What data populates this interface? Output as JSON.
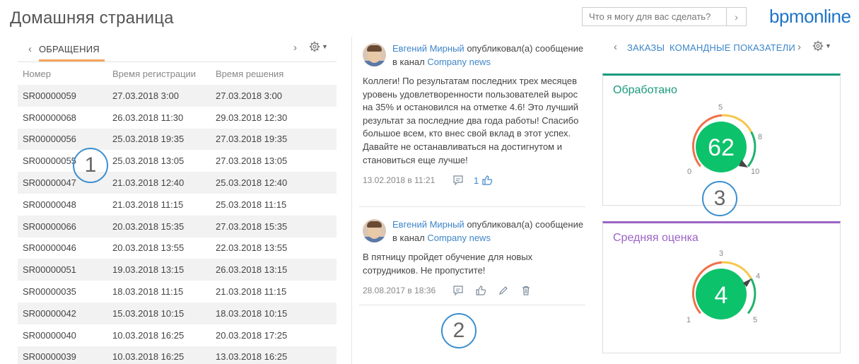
{
  "header": {
    "page_title": "Домашняя страница",
    "search_placeholder": "Что я могу для вас сделать?",
    "logo": "bpmonline"
  },
  "left": {
    "tab_label": "ОБРАЩЕНИЯ",
    "columns": [
      "Номер",
      "Время регистрации",
      "Время решения"
    ],
    "rows": [
      [
        "SR00000059",
        "27.03.2018 3:00",
        "27.03.2018 3:00"
      ],
      [
        "SR00000068",
        "26.03.2018 11:30",
        "29.03.2018 12:30"
      ],
      [
        "SR00000056",
        "25.03.2018 19:35",
        "27.03.2018 19:35"
      ],
      [
        "SR00000055",
        "25.03.2018 13:05",
        "27.03.2018 13:05"
      ],
      [
        "SR00000047",
        "21.03.2018 12:40",
        "25.03.2018 12:40"
      ],
      [
        "SR00000048",
        "21.03.2018 11:15",
        "25.03.2018 11:15"
      ],
      [
        "SR00000066",
        "20.03.2018 15:35",
        "27.03.2018 15:35"
      ],
      [
        "SR00000046",
        "20.03.2018 13:55",
        "22.03.2018 13:55"
      ],
      [
        "SR00000051",
        "19.03.2018 13:15",
        "26.03.2018 13:15"
      ],
      [
        "SR00000035",
        "18.03.2018 11:15",
        "21.03.2018 11:15"
      ],
      [
        "SR00000042",
        "15.03.2018 10:15",
        "18.03.2018 10:15"
      ],
      [
        "SR00000040",
        "10.03.2018 16:25",
        "20.03.2018 17:25"
      ],
      [
        "SR00000039",
        "10.03.2018 16:25",
        "13.03.2018 16:25"
      ]
    ]
  },
  "feed": {
    "posts": [
      {
        "author": "Евгений Мирный",
        "action": "опубликовал(а) сообщение в канал",
        "channel": "Company news",
        "text": "Коллеги! По результатам последних трех месяцев уровень удовлетворенности пользователей вырос на 35% и остановился на отметке 4.6! Это лучший результат за последние два года работы! Спасибо большое всем, кто внес свой вклад в этот успех. Давайте не останавливаться на достигнутом и становиться еще лучше!",
        "date": "13.02.2018 в 11:21",
        "likes": "1"
      },
      {
        "author": "Евгений Мирный",
        "action": "опубликовал(а) сообщение в канал",
        "channel": "Company news",
        "text": "В пятницу пройдет обучение для новых сотрудников. Не пропустите!",
        "date": "28.08.2017 в 18:36",
        "likes": ""
      }
    ]
  },
  "right": {
    "tabs": [
      "ЗАКАЗЫ",
      "КОМАНДНЫЕ ПОКАЗАТЕЛИ"
    ],
    "widgets": [
      {
        "title": "Обработано",
        "color": "#1a9a7d",
        "value": "62",
        "ticks": [
          "0",
          "5",
          "8",
          "10"
        ]
      },
      {
        "title": "Средняя оценка",
        "color": "#9b63c4",
        "value": "4",
        "ticks": [
          "1",
          "3",
          "4",
          "5"
        ]
      }
    ]
  },
  "callouts": [
    "1",
    "2",
    "3"
  ],
  "colors": {
    "accent_orange": "#f5a45f",
    "link_blue": "#3d86c9",
    "gauge_green": "#0cc26b"
  }
}
